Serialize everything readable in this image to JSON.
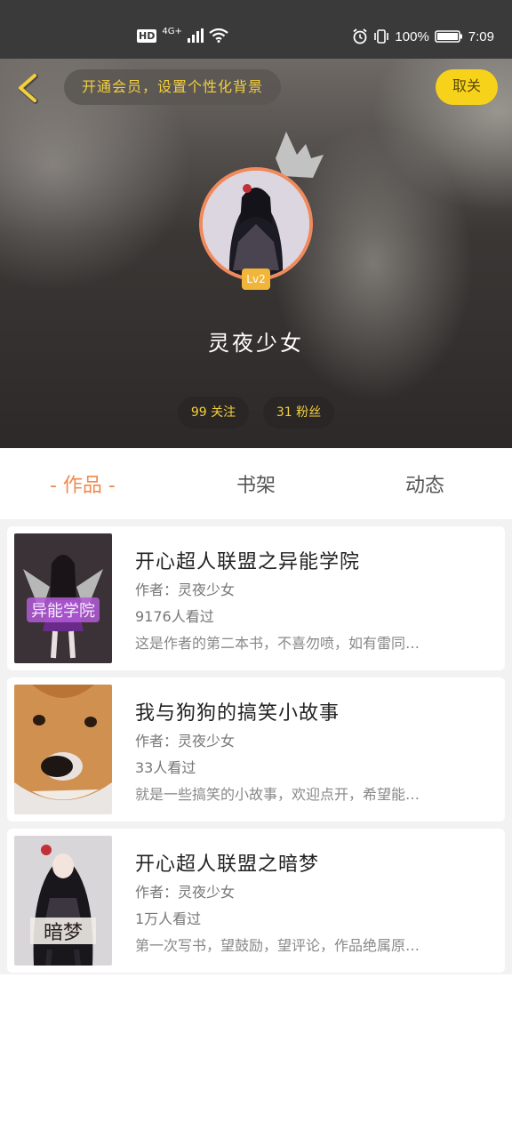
{
  "status_bar": {
    "hd": "HD",
    "network": "4G+",
    "battery_pct": "100%",
    "time": "7:09",
    "icons": [
      "signal-icon",
      "wifi-icon",
      "alarm-icon",
      "vibrate-icon",
      "battery-icon"
    ]
  },
  "header": {
    "vip_banner": "开通会员，设置个性化背景",
    "unfollow_label": "取关",
    "level_badge": "Lv2",
    "nickname": "灵夜少女",
    "following_label": "99 关注",
    "followers_label": "31 粉丝"
  },
  "tabs": [
    {
      "label": "- 作品 -",
      "active": true
    },
    {
      "label": "书架",
      "active": false
    },
    {
      "label": "动态",
      "active": false
    }
  ],
  "books": [
    {
      "title": "开心超人联盟之异能学院",
      "author": "作者：灵夜少女",
      "views": "9176人看过",
      "desc": "这是作者的第二本书，不喜勿喷，如有雷同…",
      "cover_text": "异能学院"
    },
    {
      "title": "我与狗狗的搞笑小故事",
      "author": "作者：灵夜少女",
      "views": "33人看过",
      "desc": "就是一些搞笑的小故事，欢迎点开，希望能…",
      "cover_text": ""
    },
    {
      "title": "开心超人联盟之暗梦",
      "author": "作者：灵夜少女",
      "views": "1万人看过",
      "desc": "第一次写书，望鼓励，望评论，作品绝属原…",
      "cover_text": "暗梦"
    }
  ],
  "colors": {
    "accent": "#f0894f",
    "vip_yellow": "#f3cf3e",
    "button_yellow": "#f7d21b"
  }
}
